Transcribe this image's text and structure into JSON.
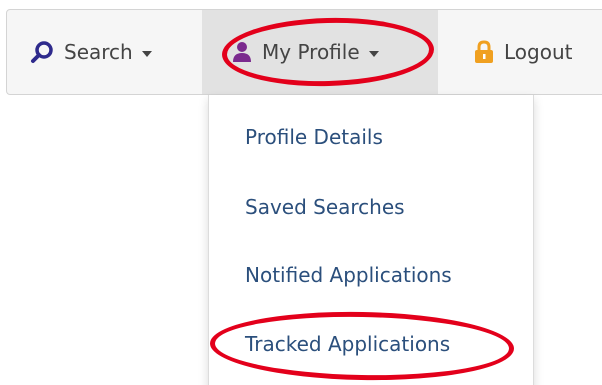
{
  "navbar": {
    "items": [
      {
        "label": "Search",
        "icon": "search-icon",
        "has_caret": true
      },
      {
        "label": "My Profile",
        "icon": "user-icon",
        "has_caret": true
      },
      {
        "label": "Logout",
        "icon": "lock-icon",
        "has_caret": false
      }
    ]
  },
  "dropdown": {
    "items": [
      {
        "label": "Profile Details"
      },
      {
        "label": "Saved Searches"
      },
      {
        "label": "Notified Applications"
      },
      {
        "label": "Tracked Applications"
      }
    ]
  },
  "colors": {
    "navbar_bg": "#f6f6f6",
    "active_item_bg": "#e2e2e2",
    "nav_text": "#444444",
    "menu_link": "#2b4f7c",
    "search_icon": "#2e2a8c",
    "user_icon": "#7b2a8e",
    "lock_icon": "#f0a020",
    "annotation": "#e3001b"
  }
}
